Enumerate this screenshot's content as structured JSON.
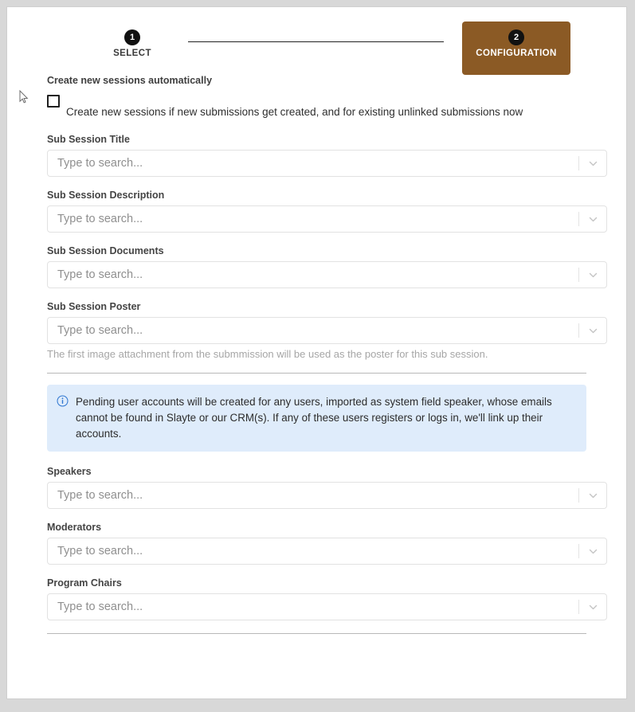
{
  "stepper": {
    "steps": [
      {
        "number": "1",
        "label": "SELECT",
        "state": "inactive"
      },
      {
        "number": "2",
        "label": "CONFIGURATION",
        "state": "active"
      }
    ],
    "active_color": "#8b5a25",
    "badge_color": "#111111",
    "connector_color": "#222222"
  },
  "auto_create": {
    "section_title": "Create new sessions automatically",
    "checkbox_label": "Create new sessions if new submissions get created, and for existing unlinked submissions now",
    "checked": false
  },
  "fields": {
    "placeholder": "Type to search...",
    "items": [
      {
        "label": "Sub Session Title",
        "value": "",
        "hint": ""
      },
      {
        "label": "Sub Session Description",
        "value": "",
        "hint": ""
      },
      {
        "label": "Sub Session Documents",
        "value": "",
        "hint": ""
      },
      {
        "label": "Sub Session Poster",
        "value": "",
        "hint": "The first image attachment from the submmission will be used as the poster for this sub session."
      },
      {
        "label": "Speakers",
        "value": "",
        "hint": ""
      },
      {
        "label": "Moderators",
        "value": "",
        "hint": ""
      },
      {
        "label": "Program Chairs",
        "value": "",
        "hint": ""
      }
    ]
  },
  "info_alert": {
    "icon": "info-circle-icon",
    "text": "Pending user accounts will be created for any users, imported as system field speaker, whose emails cannot be found in Slayte or our CRM(s). If any of these users registers or logs in, we'll link up their accounts.",
    "background": "#dfecfb",
    "icon_color": "#2f76d1"
  },
  "icons": {
    "chevron_down": "chevron-down-icon",
    "cursor": "mouse-pointer-icon"
  }
}
